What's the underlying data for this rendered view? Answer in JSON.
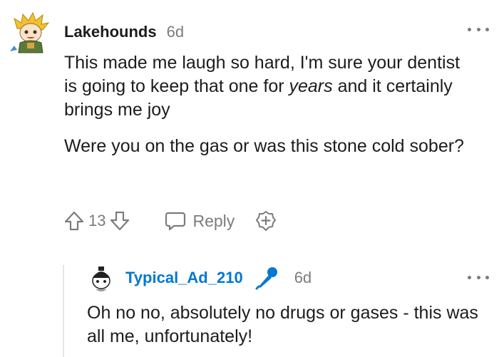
{
  "comment": {
    "username": "Lakehounds",
    "time": "6d",
    "paragraph1_before": "This made me laugh so hard, I'm sure your dentist is going to keep that one for ",
    "paragraph1_emphasis": "years",
    "paragraph1_after": " and it certainly brings me joy",
    "paragraph2": "Were you on the gas or was this stone cold sober?",
    "votes": "13",
    "reply_label": "Reply",
    "icons": {
      "upvote": "arrow-up-icon",
      "downvote": "arrow-down-icon",
      "reply": "speech-bubble-icon",
      "award": "plus-award-icon",
      "more": "more-dots-icon"
    }
  },
  "reply": {
    "username": "Typical_Ad_210",
    "time": "6d",
    "text": "Oh no no, absolutely no drugs or gases - this was all me, unfortunately!",
    "icons": {
      "badge": "microphone-icon",
      "more": "more-dots-icon"
    }
  },
  "colors": {
    "username_link": "#0079d3",
    "meta_gray": "#7c7c7c",
    "text": "#1c1c1c",
    "thread_line": "#e6e6e6"
  }
}
